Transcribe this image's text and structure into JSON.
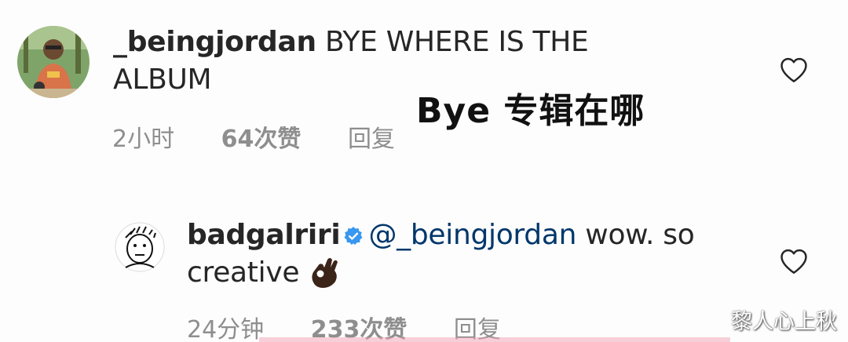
{
  "comments": [
    {
      "username": "_beingjordan",
      "text_line1": "BYE WHERE IS THE",
      "text_line2": "ALBUM",
      "time": "2小时",
      "likes": "64次赞",
      "reply_label": "回复",
      "icon": "heart-outline-icon"
    },
    {
      "username": "badgalriri",
      "verified_icon": "verified-badge-icon",
      "mention": "@_beingjordan",
      "text_line1_rest": "wow. so",
      "text_line2": "creative",
      "emoji": "ok-hand-emoji",
      "time": "24分钟",
      "likes": "233次赞",
      "reply_label": "回复",
      "icon": "heart-outline-icon"
    }
  ],
  "caption": "Bye 专辑在哪",
  "watermark": "黎人心上秋",
  "colors": {
    "text": "#262626",
    "meta": "#8e8e8e",
    "mention": "#00376b",
    "verified": "#3897f0"
  }
}
